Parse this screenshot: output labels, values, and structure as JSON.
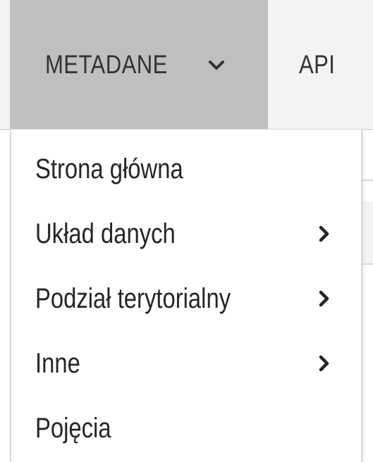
{
  "nav": {
    "items": [
      {
        "label": "METADANE",
        "active": true,
        "icon": "chevron-down-icon"
      },
      {
        "label": "API",
        "active": false
      }
    ]
  },
  "dropdown": {
    "items": [
      {
        "label": "Strona główna",
        "has_submenu": false
      },
      {
        "label": "Układ danych",
        "has_submenu": true,
        "icon": "chevron-right-icon"
      },
      {
        "label": "Podział terytorialny",
        "has_submenu": true,
        "icon": "chevron-right-icon"
      },
      {
        "label": "Inne",
        "has_submenu": true,
        "icon": "chevron-right-icon"
      },
      {
        "label": "Pojęcia",
        "has_submenu": false
      }
    ]
  },
  "colors": {
    "nav_background": "#f3f3f3",
    "active_tab": "#bfbfbf",
    "text": "#262626",
    "menu_background": "#ffffff"
  }
}
